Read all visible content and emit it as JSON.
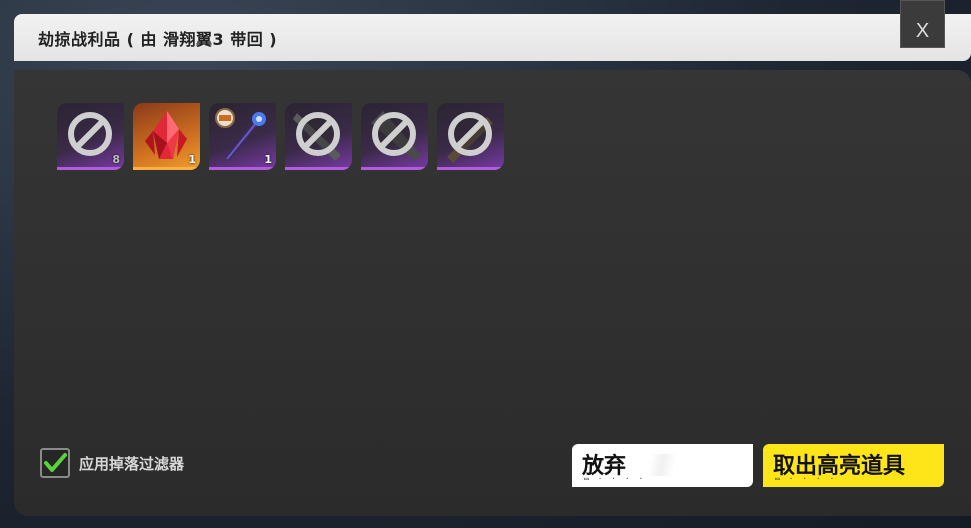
{
  "dialog": {
    "title": "劫掠战利品 ( 由 滑翔翼3 带回 )",
    "close_label": "X"
  },
  "items": [
    {
      "icon": "blocked-icon",
      "quantity": "8",
      "rarity": "purple"
    },
    {
      "icon": "red-crystal-icon",
      "quantity": "1",
      "rarity": "orange"
    },
    {
      "icon": "magic-staff-icon",
      "quantity": "1",
      "rarity": "purple"
    },
    {
      "icon": "blocked-icon",
      "quantity": "",
      "rarity": "purple"
    },
    {
      "icon": "blocked-icon",
      "quantity": "",
      "rarity": "purple"
    },
    {
      "icon": "blocked-icon",
      "quantity": "",
      "rarity": "purple"
    }
  ],
  "filter": {
    "label": "应用掉落过滤器",
    "checked": true,
    "check_color": "#5ad43a"
  },
  "buttons": {
    "discard_label": "放弃",
    "discard_key": "▭ · · · ·",
    "take_label": "取出高亮道具",
    "take_key": "▭ · · · ·",
    "take_color": "#fde51a"
  }
}
